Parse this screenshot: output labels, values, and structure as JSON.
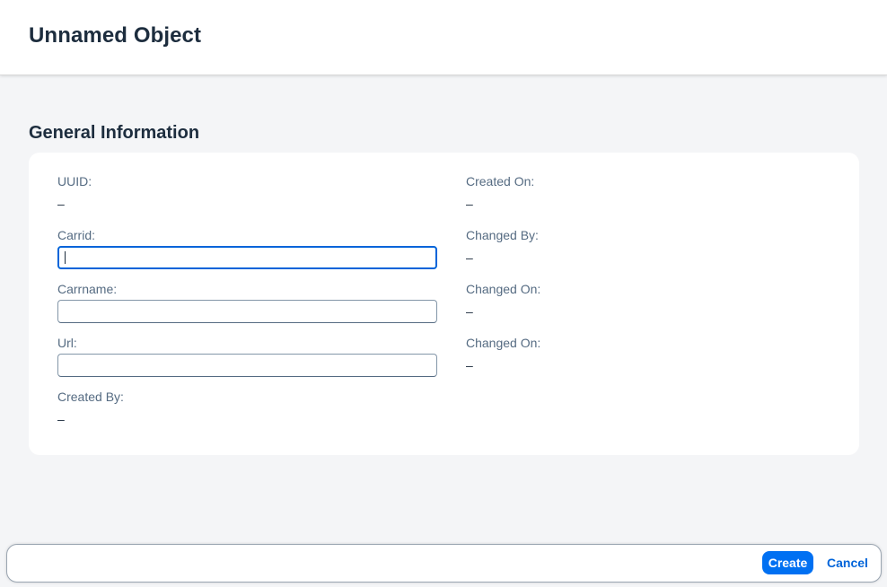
{
  "header": {
    "title": "Unnamed Object"
  },
  "section": {
    "title": "General Information"
  },
  "form": {
    "left": [
      {
        "label": "UUID:",
        "value": "–"
      },
      {
        "label": "Carrid:",
        "input_value": "",
        "placeholder": ""
      },
      {
        "label": "Carrname:",
        "input_value": "",
        "placeholder": ""
      },
      {
        "label": "Url:",
        "input_value": "",
        "placeholder": ""
      },
      {
        "label": "Created By:",
        "value": "–"
      }
    ],
    "right": [
      {
        "label": "Created On:",
        "value": "–"
      },
      {
        "label": "Changed By:",
        "value": "–"
      },
      {
        "label": "Changed On:",
        "value": "–"
      },
      {
        "label": "Changed On:",
        "value": "–"
      }
    ]
  },
  "footer": {
    "create_label": "Create",
    "cancel_label": "Cancel"
  },
  "colors": {
    "accent": "#0070f2",
    "focus": "#0064d9",
    "background": "#f4f5f7"
  }
}
